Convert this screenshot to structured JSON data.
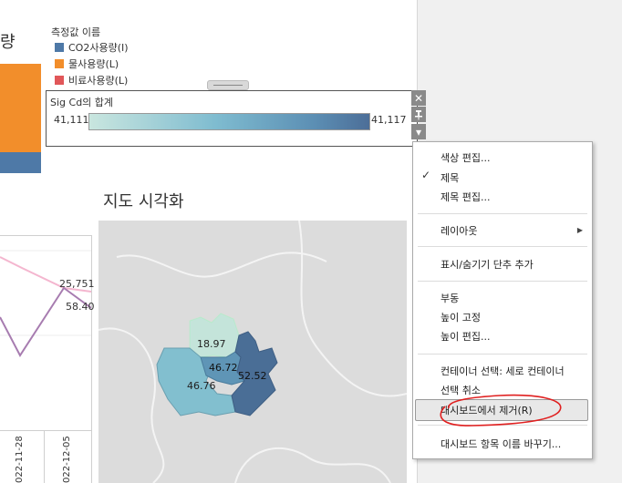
{
  "left_panel": {
    "title_fragment": "량"
  },
  "legend": {
    "title": "측정값 이름",
    "items": [
      {
        "label": "CO2사용량(I)",
        "color": "#4e79a7"
      },
      {
        "label": "물사용량(L)",
        "color": "#f28e2b"
      },
      {
        "label": "비료사용량(L)",
        "color": "#e15759"
      }
    ]
  },
  "color_legend": {
    "title": "Sig Cd의 합계",
    "min": "41,111",
    "max": "41,117"
  },
  "controls": {
    "close": "✕",
    "pin": "📌",
    "dropdown": "▾"
  },
  "map": {
    "title": "지도 시각화",
    "regions": [
      {
        "label": "18.97",
        "color": "#c4e4da"
      },
      {
        "label": "46.72",
        "color": "#5f95b6"
      },
      {
        "label": "52.52",
        "color": "#4a6e96"
      },
      {
        "label": "46.76",
        "color": "#82bfcf"
      }
    ]
  },
  "line_chart": {
    "value_labels": [
      "25,751",
      "58.40"
    ],
    "x_labels": [
      "022-11-28",
      "022-12-05"
    ]
  },
  "context_menu": {
    "items": [
      {
        "label": "색상 편집..."
      },
      {
        "label": "제목",
        "checked": true
      },
      {
        "label": "제목 편집..."
      },
      {
        "label": "레이아웃",
        "submenu": true
      },
      {
        "label": "표시/숨기기 단추 추가"
      },
      {
        "label": "부동"
      },
      {
        "label": "높이 고정"
      },
      {
        "label": "높이 편집..."
      },
      {
        "label": "컨테이너 선택: 세로 컨테이너"
      },
      {
        "label": "선택 취소"
      },
      {
        "label": "대시보드에서 제거(R)",
        "highlighted": true
      },
      {
        "label": "대시보드 항목 이름 바꾸기..."
      }
    ]
  }
}
